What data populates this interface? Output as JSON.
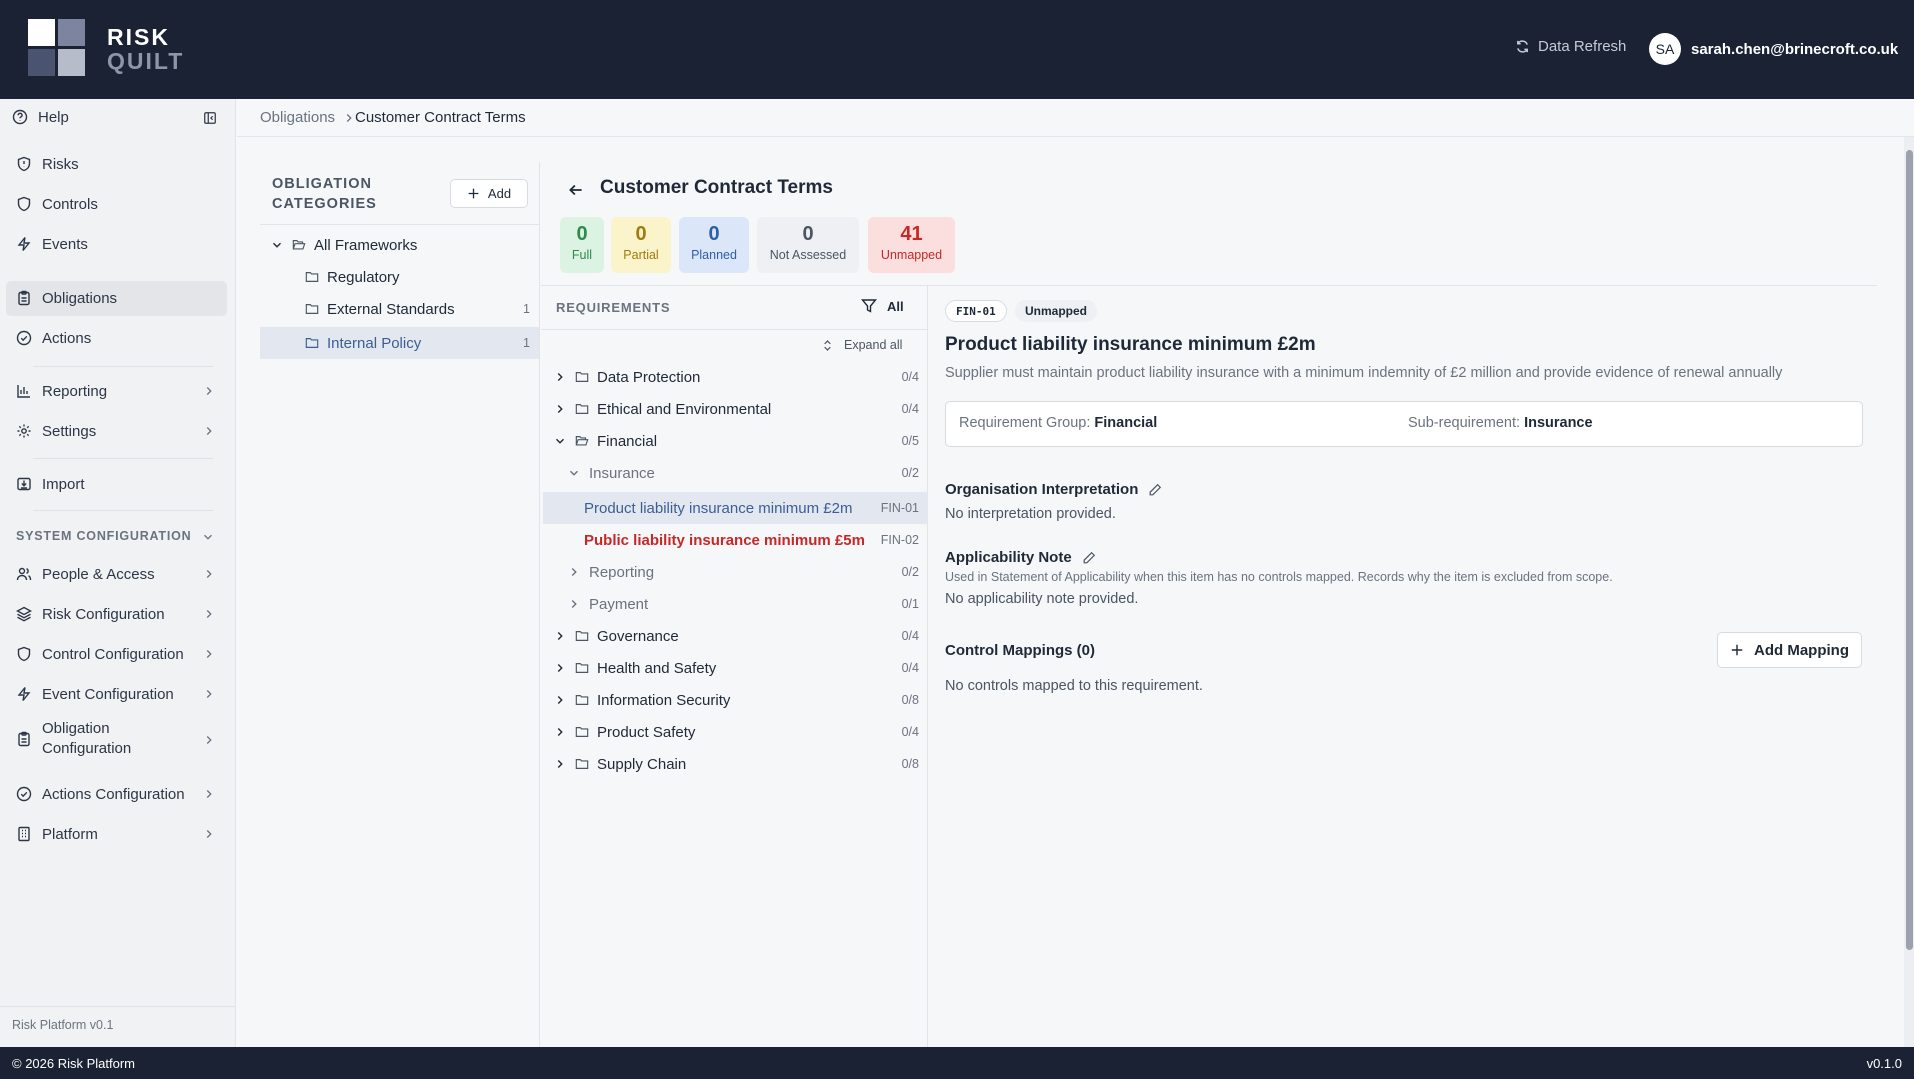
{
  "header": {
    "brand_line1": "RISK",
    "brand_line2": "QUILT",
    "refresh_label": "Data Refresh",
    "user_initials": "SA",
    "user_email": "sarah.chen@brinecroft.co.uk"
  },
  "sidebar": {
    "help": "Help",
    "items": [
      {
        "label": "Risks",
        "icon": "shield-icon"
      },
      {
        "label": "Controls",
        "icon": "shield-outline-icon"
      },
      {
        "label": "Events",
        "icon": "lightning-icon"
      },
      {
        "label": "Obligations",
        "icon": "clipboard-icon"
      },
      {
        "label": "Actions",
        "icon": "check-circle-icon"
      },
      {
        "label": "Reporting",
        "icon": "bar-chart-icon"
      },
      {
        "label": "Settings",
        "icon": "gear-icon"
      },
      {
        "label": "Import",
        "icon": "import-icon"
      }
    ],
    "system_heading": "SYSTEM CONFIGURATION",
    "system_items": [
      {
        "label": "People & Access"
      },
      {
        "label": "Risk Configuration"
      },
      {
        "label": "Control Configuration"
      },
      {
        "label": "Event Configuration"
      },
      {
        "label": "Obligation",
        "label2": "Configuration"
      },
      {
        "label": "Actions Configuration"
      },
      {
        "label": "Platform"
      }
    ],
    "version": "Risk Platform v0.1"
  },
  "breadcrumb": {
    "parent": "Obligations",
    "current": "Customer Contract Terms"
  },
  "categories": {
    "heading_line1": "OBLIGATION",
    "heading_line2": "CATEGORIES",
    "add_label": "Add",
    "root": "All Frameworks",
    "items": [
      {
        "label": "Regulatory",
        "count": ""
      },
      {
        "label": "External Standards",
        "count": "1"
      },
      {
        "label": "Internal Policy",
        "count": "1"
      }
    ]
  },
  "detail": {
    "title": "Customer Contract Terms",
    "stats": [
      {
        "value": "0",
        "label": "Full"
      },
      {
        "value": "0",
        "label": "Partial"
      },
      {
        "value": "0",
        "label": "Planned"
      },
      {
        "value": "0",
        "label": "Not Assessed"
      },
      {
        "value": "41",
        "label": "Unmapped"
      }
    ]
  },
  "requirements": {
    "heading": "REQUIREMENTS",
    "filter_label": "All",
    "expand_label": "Expand all",
    "tree": [
      {
        "label": "Data Protection",
        "count": "0/4"
      },
      {
        "label": "Ethical and Environmental",
        "count": "0/4"
      },
      {
        "label": "Financial",
        "count": "0/5"
      },
      {
        "label": "Insurance",
        "count": "0/2"
      },
      {
        "label": "Product liability insurance minimum £2m",
        "count": "FIN-01"
      },
      {
        "label": "Public liability insurance minimum £5m",
        "count": "FIN-02"
      },
      {
        "label": "Reporting",
        "count": "0/2"
      },
      {
        "label": "Payment",
        "count": "0/1"
      },
      {
        "label": "Governance",
        "count": "0/4"
      },
      {
        "label": "Health and Safety",
        "count": "0/4"
      },
      {
        "label": "Information Security",
        "count": "0/8"
      },
      {
        "label": "Product Safety",
        "count": "0/4"
      },
      {
        "label": "Supply Chain",
        "count": "0/8"
      }
    ]
  },
  "panel": {
    "code": "FIN-01",
    "status": "Unmapped",
    "title": "Product liability insurance minimum £2m",
    "description": "Supplier must maintain product liability insurance with a minimum indemnity of £2 million and provide evidence of renewal annually",
    "group_label": "Requirement Group:",
    "group_value": "Financial",
    "sub_label": "Sub-requirement:",
    "sub_value": "Insurance",
    "interp_label": "Organisation Interpretation",
    "interp_value": "No interpretation provided.",
    "applic_label": "Applicability Note",
    "applic_help": "Used in Statement of Applicability when this item has no controls mapped. Records why the item is excluded from scope.",
    "applic_value": "No applicability note provided.",
    "mappings_label": "Control Mappings (0)",
    "add_mapping": "Add Mapping",
    "mappings_empty": "No controls mapped to this requirement."
  },
  "footer": {
    "copyright": "© 2026 Risk Platform",
    "version": "v0.1.0"
  },
  "colors": {
    "header_bg": "#1a2233",
    "unmapped": "#c62828",
    "link": "#3b5f95"
  }
}
